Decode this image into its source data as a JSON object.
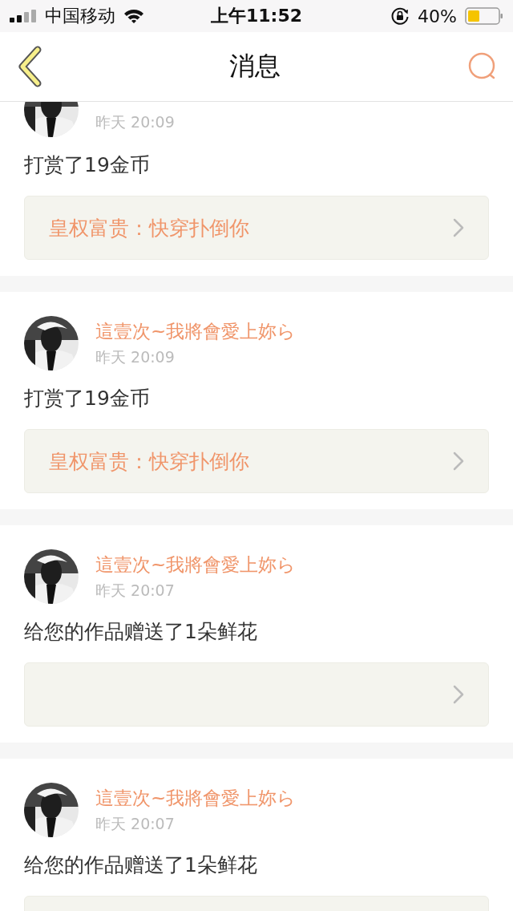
{
  "status_bar": {
    "carrier": "中国移动",
    "time": "上午11:52",
    "battery": "40%"
  },
  "header": {
    "title": "消息"
  },
  "messages": [
    {
      "time": "昨天 20:09",
      "text": "打赏了19金币",
      "link": {
        "kind": "titled",
        "title": "皇权富贵：快穿扑倒你"
      }
    },
    {
      "name": "這壹次~我將會愛上妳ら",
      "time": "昨天 20:09",
      "text": "打赏了19金币",
      "link": {
        "kind": "titled",
        "title": "皇权富贵：快穿扑倒你"
      }
    },
    {
      "name": "這壹次~我將會愛上妳ら",
      "time": "昨天 20:07",
      "text": "给您的作品赠送了1朵鲜花",
      "link": {
        "kind": "empty"
      }
    },
    {
      "name": "這壹次~我將會愛上妳ら",
      "time": "昨天 20:07",
      "text": "给您的作品赠送了1朵鲜花",
      "link": {
        "kind": "edge"
      }
    }
  ]
}
